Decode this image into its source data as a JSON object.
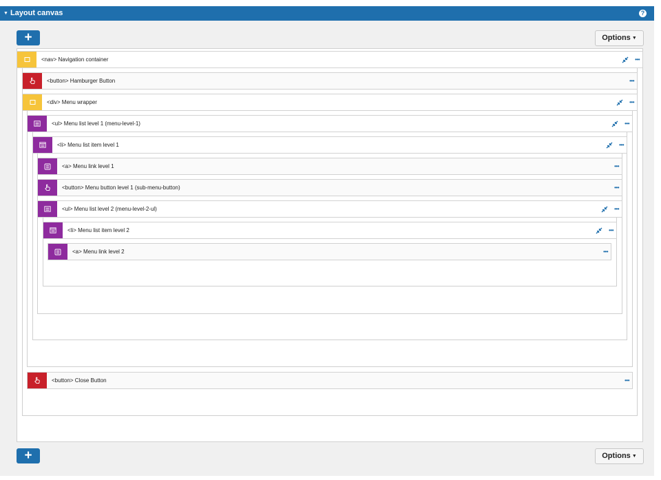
{
  "header": {
    "title": "Layout canvas",
    "help_icon": "question-circle-icon"
  },
  "toolbar": {
    "add_label": "+",
    "options_label": "Options"
  },
  "rows": [
    {
      "label": "<nav> Navigation container",
      "badge": "yellow",
      "icon": "square-outline-icon",
      "collapsible": true
    },
    {
      "label": "<button> Hamburger Button",
      "badge": "red",
      "icon": "hand-pointer-icon",
      "collapsible": false
    },
    {
      "label": "<div> Menu wrapper",
      "badge": "yellow",
      "icon": "square-outline-icon",
      "collapsible": true
    },
    {
      "label": "<ul> Menu list level 1 (menu-level-1)",
      "badge": "purple",
      "icon": "list-icon",
      "collapsible": true
    },
    {
      "label": "<li> Menu list item level 1",
      "badge": "purple",
      "icon": "list-item-icon",
      "collapsible": true
    },
    {
      "label": "<a> Menu link level 1",
      "badge": "purple",
      "icon": "link-block-icon",
      "collapsible": false
    },
    {
      "label": "<button> Menu button level 1 (sub-menu-button)",
      "badge": "purple",
      "icon": "hand-pointer-icon",
      "collapsible": false
    },
    {
      "label": "<ul> Menu list level 2 (menu-level-2-ul)",
      "badge": "purple",
      "icon": "list-icon",
      "collapsible": true
    },
    {
      "label": "<li> Menu list item level 2",
      "badge": "purple",
      "icon": "list-item-icon",
      "collapsible": true
    },
    {
      "label": "<a> Menu link level 2",
      "badge": "purple",
      "icon": "link-block-icon",
      "collapsible": false
    },
    {
      "label": "<button> Close Button",
      "badge": "red",
      "icon": "hand-pointer-icon",
      "collapsible": false
    }
  ],
  "colors": {
    "accent": "#1f6fad",
    "container": "#f6c43b",
    "interactive": "#c8202a",
    "list": "#8e2b9e"
  }
}
